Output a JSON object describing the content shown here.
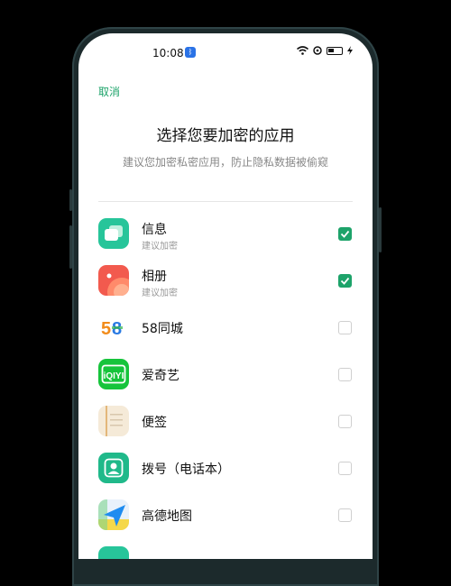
{
  "status_bar": {
    "time": "10:08"
  },
  "header": {
    "cancel_label": "取消",
    "title": "选择您要加密的应用",
    "subtitle": "建议您加密私密应用，防止隐私数据被偷窥"
  },
  "apps": [
    {
      "name": "信息",
      "sub": "建议加密",
      "checked": true,
      "icon": "messages-icon",
      "color": "#27c59a"
    },
    {
      "name": "相册",
      "sub": "建议加密",
      "checked": true,
      "icon": "photos-icon",
      "color": "#f25a4e"
    },
    {
      "name": "58同城",
      "sub": "",
      "checked": false,
      "icon": "58-tongcheng-icon",
      "color": "#ffffff"
    },
    {
      "name": "爱奇艺",
      "sub": "",
      "checked": false,
      "icon": "iqiyi-icon",
      "color": "#16c43b"
    },
    {
      "name": "便签",
      "sub": "",
      "checked": false,
      "icon": "notes-icon",
      "color": "#f5ead8"
    },
    {
      "name": "拨号（电话本）",
      "sub": "",
      "checked": false,
      "icon": "dialer-icon",
      "color": "#20b98a"
    },
    {
      "name": "高德地图",
      "sub": "",
      "checked": false,
      "icon": "amap-icon",
      "color": "#e8f1fb"
    }
  ],
  "colors": {
    "accent": "#1da36a"
  }
}
